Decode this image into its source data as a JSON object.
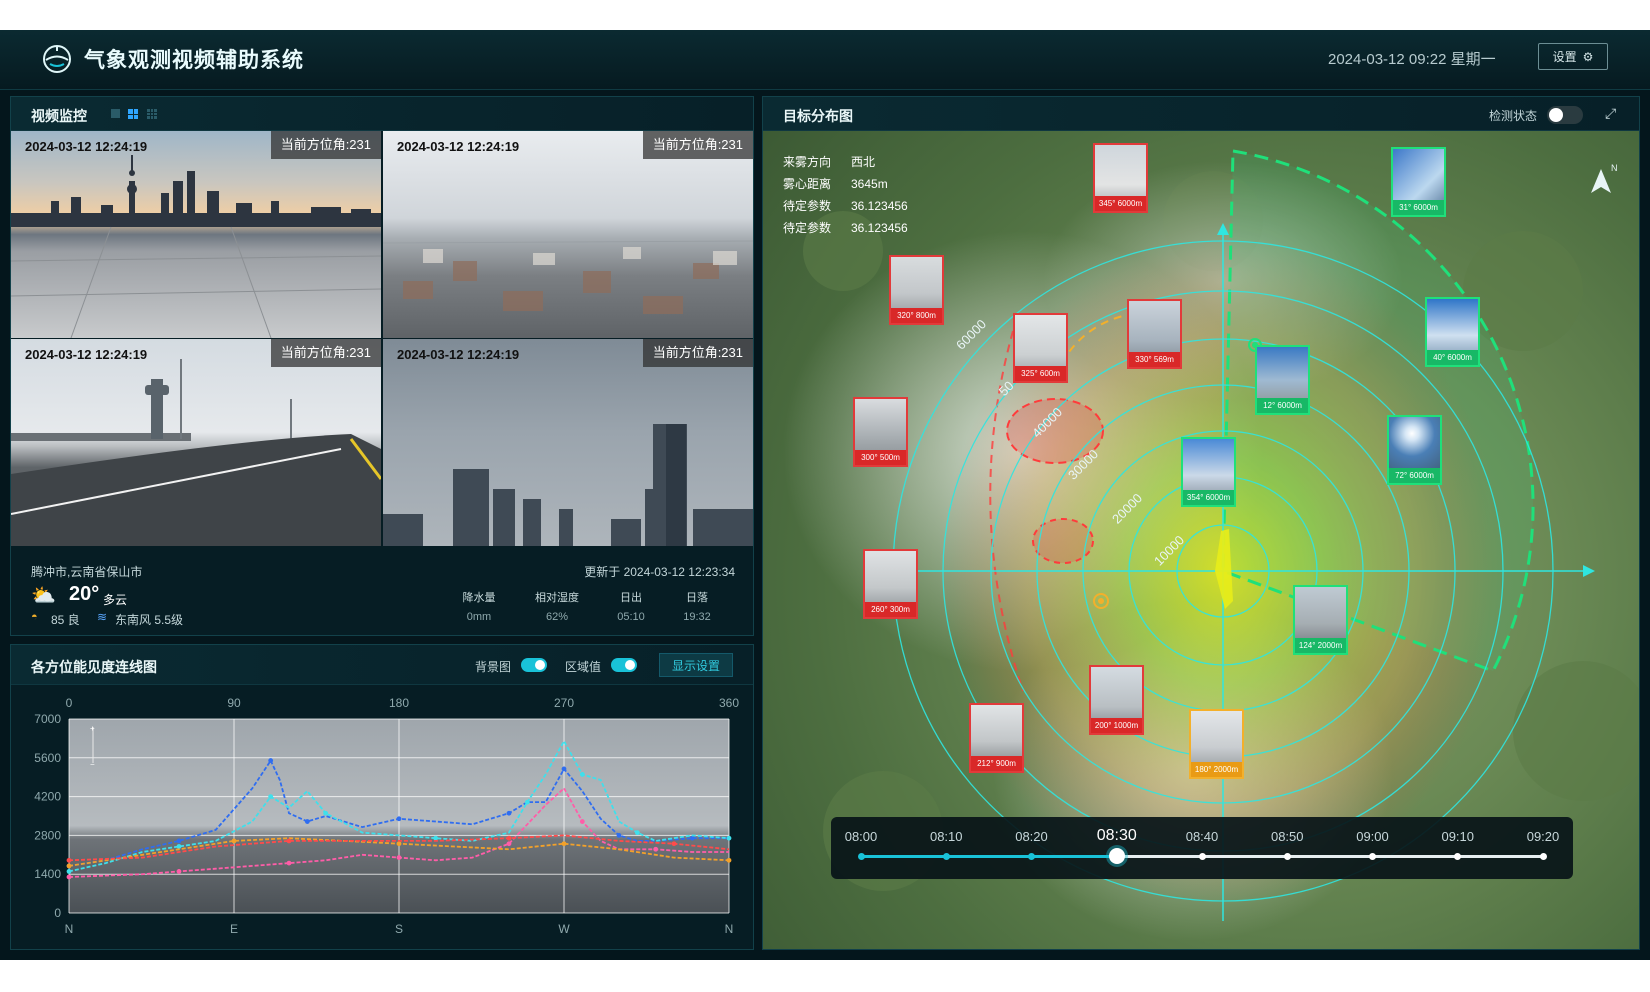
{
  "header": {
    "title": "气象观测视频辅助系统",
    "datetime": "2024-03-12 09:22 星期一",
    "settings_label": "设置"
  },
  "video_panel": {
    "title": "视频监控",
    "tiles": [
      {
        "timestamp": "2024-03-12 12:24:19",
        "azimuth": "当前方位角:231"
      },
      {
        "timestamp": "2024-03-12 12:24:19",
        "azimuth": "当前方位角:231"
      },
      {
        "timestamp": "2024-03-12 12:24:19",
        "azimuth": "当前方位角:231"
      },
      {
        "timestamp": "2024-03-12 12:24:19",
        "azimuth": "当前方位角:231"
      }
    ],
    "weather": {
      "location": "腾冲市,云南省保山市",
      "updated": "更新于 2024-03-12 12:23:34",
      "temperature": "20°",
      "condition": "多云",
      "aqi": "85 良",
      "wind": "东南风 5.5级",
      "stats": [
        {
          "label": "降水量",
          "value": "0mm"
        },
        {
          "label": "相对湿度",
          "value": "62%"
        },
        {
          "label": "日出",
          "value": "05:10"
        },
        {
          "label": "日落",
          "value": "19:32"
        }
      ]
    }
  },
  "visibility_panel": {
    "title": "各方位能见度连线图",
    "background_toggle_label": "背景图",
    "background_toggle_on": true,
    "threshold_toggle_label": "区域值",
    "threshold_toggle_on": true,
    "display_settings_label": "显示设置"
  },
  "chart_data": {
    "type": "line",
    "x_top_ticks": [
      "0",
      "90",
      "180",
      "270",
      "360"
    ],
    "x_bottom_ticks": [
      "N",
      "E",
      "S",
      "W",
      "N"
    ],
    "y_ticks": [
      "7000",
      "5600",
      "4200",
      "2800",
      "1400",
      "0"
    ],
    "xlim": [
      0,
      360
    ],
    "ylim": [
      0,
      7000
    ],
    "grid": true,
    "series": [
      {
        "color": "#2f6df0",
        "x": [
          0,
          20,
          40,
          60,
          80,
          100,
          110,
          115,
          120,
          130,
          140,
          160,
          180,
          200,
          220,
          240,
          250,
          260,
          270,
          280,
          290,
          300,
          310,
          320,
          340,
          360
        ],
        "y": [
          1700,
          1900,
          2300,
          2600,
          3000,
          4500,
          5500,
          4800,
          3600,
          3300,
          3500,
          3100,
          3400,
          3300,
          3200,
          3600,
          4000,
          4000,
          5200,
          4400,
          3400,
          2800,
          2600,
          2600,
          2700,
          2700
        ]
      },
      {
        "color": "#3ee0ec",
        "x": [
          0,
          20,
          40,
          60,
          80,
          100,
          110,
          120,
          130,
          140,
          160,
          180,
          200,
          220,
          240,
          250,
          260,
          270,
          280,
          290,
          300,
          310,
          320,
          340,
          360
        ],
        "y": [
          1500,
          1800,
          2200,
          2400,
          2600,
          3300,
          4200,
          3800,
          4400,
          3600,
          2900,
          2800,
          2700,
          2600,
          2900,
          4000,
          5000,
          6200,
          5000,
          4800,
          3300,
          2900,
          2600,
          2800,
          2700
        ]
      },
      {
        "color": "#ff5da8",
        "x": [
          0,
          20,
          40,
          60,
          80,
          100,
          120,
          140,
          160,
          180,
          200,
          220,
          240,
          260,
          270,
          280,
          290,
          300,
          320,
          340,
          360
        ],
        "y": [
          1300,
          1350,
          1400,
          1500,
          1600,
          1700,
          1800,
          1900,
          2100,
          2000,
          1900,
          2000,
          2500,
          3900,
          4500,
          3300,
          2600,
          2300,
          2300,
          2200,
          2200
        ]
      },
      {
        "color": "#f3a12a",
        "x": [
          0,
          30,
          60,
          90,
          120,
          150,
          180,
          210,
          240,
          270,
          300,
          330,
          360
        ],
        "y": [
          1700,
          2000,
          2300,
          2600,
          2700,
          2600,
          2500,
          2400,
          2300,
          2500,
          2300,
          2000,
          1900
        ]
      },
      {
        "color": "#ff4b4b",
        "x": [
          0,
          40,
          80,
          120,
          160,
          200,
          240,
          270,
          300,
          330,
          360
        ],
        "y": [
          1900,
          2000,
          2400,
          2600,
          2600,
          2600,
          2700,
          2800,
          2600,
          2500,
          2300
        ]
      }
    ]
  },
  "map_panel": {
    "title": "目标分布图",
    "detection_label": "检测状态",
    "detection_on": false,
    "info": [
      {
        "label": "来雾方向",
        "value": "西北"
      },
      {
        "label": "雾心距离",
        "value": "3645m"
      },
      {
        "label": "待定参数",
        "value": "36.123456"
      },
      {
        "label": "待定参数",
        "value": "36.123456"
      }
    ],
    "ring_labels": [
      "60000",
      "50",
      "40000",
      "30000",
      "20000",
      "10000"
    ],
    "targets": [
      {
        "caption": "345° 6000m",
        "status": "red"
      },
      {
        "caption": "31° 6000m",
        "status": "green"
      },
      {
        "caption": "320° 800m",
        "status": "red"
      },
      {
        "caption": "325° 600m",
        "status": "red"
      },
      {
        "caption": "330° 569m",
        "status": "red"
      },
      {
        "caption": "40° 6000m",
        "status": "green"
      },
      {
        "caption": "12° 6000m",
        "status": "green"
      },
      {
        "caption": "300° 500m",
        "status": "red"
      },
      {
        "caption": "72° 6000m",
        "status": "green"
      },
      {
        "caption": "354° 6000m",
        "status": "green"
      },
      {
        "caption": "260° 300m",
        "status": "red"
      },
      {
        "caption": "124° 2000m",
        "status": "green"
      },
      {
        "caption": "200° 1000m",
        "status": "red"
      },
      {
        "caption": "212° 900m",
        "status": "red"
      },
      {
        "caption": "180° 2000m",
        "status": "yellow"
      }
    ],
    "timeline": {
      "times": [
        "08:00",
        "08:10",
        "08:20",
        "08:30",
        "08:40",
        "08:50",
        "09:00",
        "09:10",
        "09:20"
      ],
      "current_index": 3
    },
    "colors": {
      "accent": "#19c2d8",
      "alert": "#e23a3a",
      "ok": "#1fe07a",
      "warn": "#f3b02b"
    }
  }
}
